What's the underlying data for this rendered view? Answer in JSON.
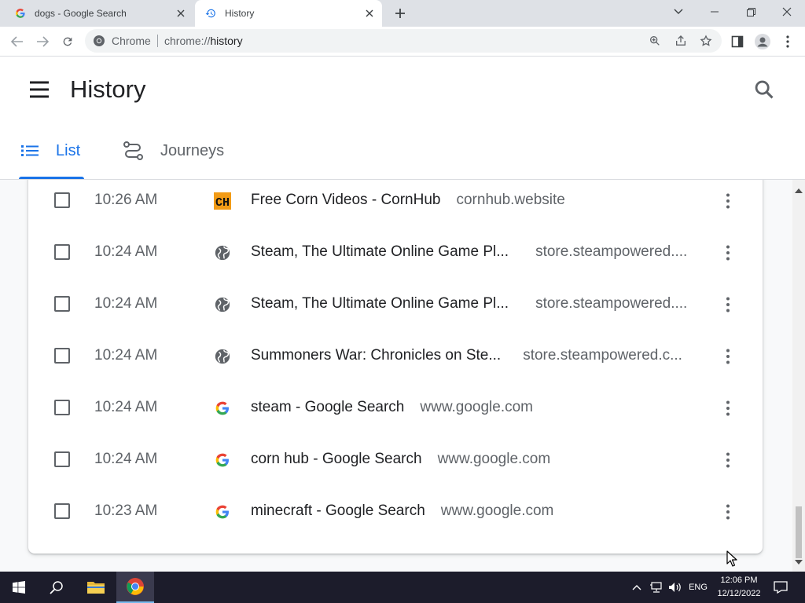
{
  "browser": {
    "tabs": [
      {
        "title": "dogs - Google Search",
        "favicon": "google-g-icon"
      },
      {
        "title": "History",
        "favicon": "history-icon",
        "active": true
      }
    ],
    "omnibox": {
      "chip": "Chrome",
      "url_scheme": "chrome://",
      "url_host": "history"
    }
  },
  "history": {
    "title": "History",
    "tabs": [
      {
        "label": "List",
        "icon": "list-icon",
        "active": true
      },
      {
        "label": "Journeys",
        "icon": "journeys-icon"
      }
    ],
    "entries": [
      {
        "time": "10:26 AM",
        "title": "Free Corn Videos - CornHub",
        "domain": "cornhub.website",
        "favicon": "cornhub-icon"
      },
      {
        "time": "10:24 AM",
        "title": "Steam, The Ultimate Online Game Pl...",
        "domain": "store.steampowered....",
        "favicon": "globe-icon"
      },
      {
        "time": "10:24 AM",
        "title": "Steam, The Ultimate Online Game Pl...",
        "domain": "store.steampowered....",
        "favicon": "globe-icon"
      },
      {
        "time": "10:24 AM",
        "title": "Summoners War: Chronicles on Ste...",
        "domain": "store.steampowered.c...",
        "favicon": "globe-icon"
      },
      {
        "time": "10:24 AM",
        "title": "steam - Google Search",
        "domain": "www.google.com",
        "favicon": "google-g-icon"
      },
      {
        "time": "10:24 AM",
        "title": "corn hub - Google Search",
        "domain": "www.google.com",
        "favicon": "google-g-icon"
      },
      {
        "time": "10:23 AM",
        "title": "minecraft - Google Search",
        "domain": "www.google.com",
        "favicon": "google-g-icon"
      }
    ]
  },
  "taskbar": {
    "language": "ENG",
    "time": "12:06 PM",
    "date": "12/12/2022"
  },
  "colors": {
    "accent": "#1a73e8",
    "tabstrip": "#dee1e6",
    "taskbar": "#1c1c2b"
  }
}
